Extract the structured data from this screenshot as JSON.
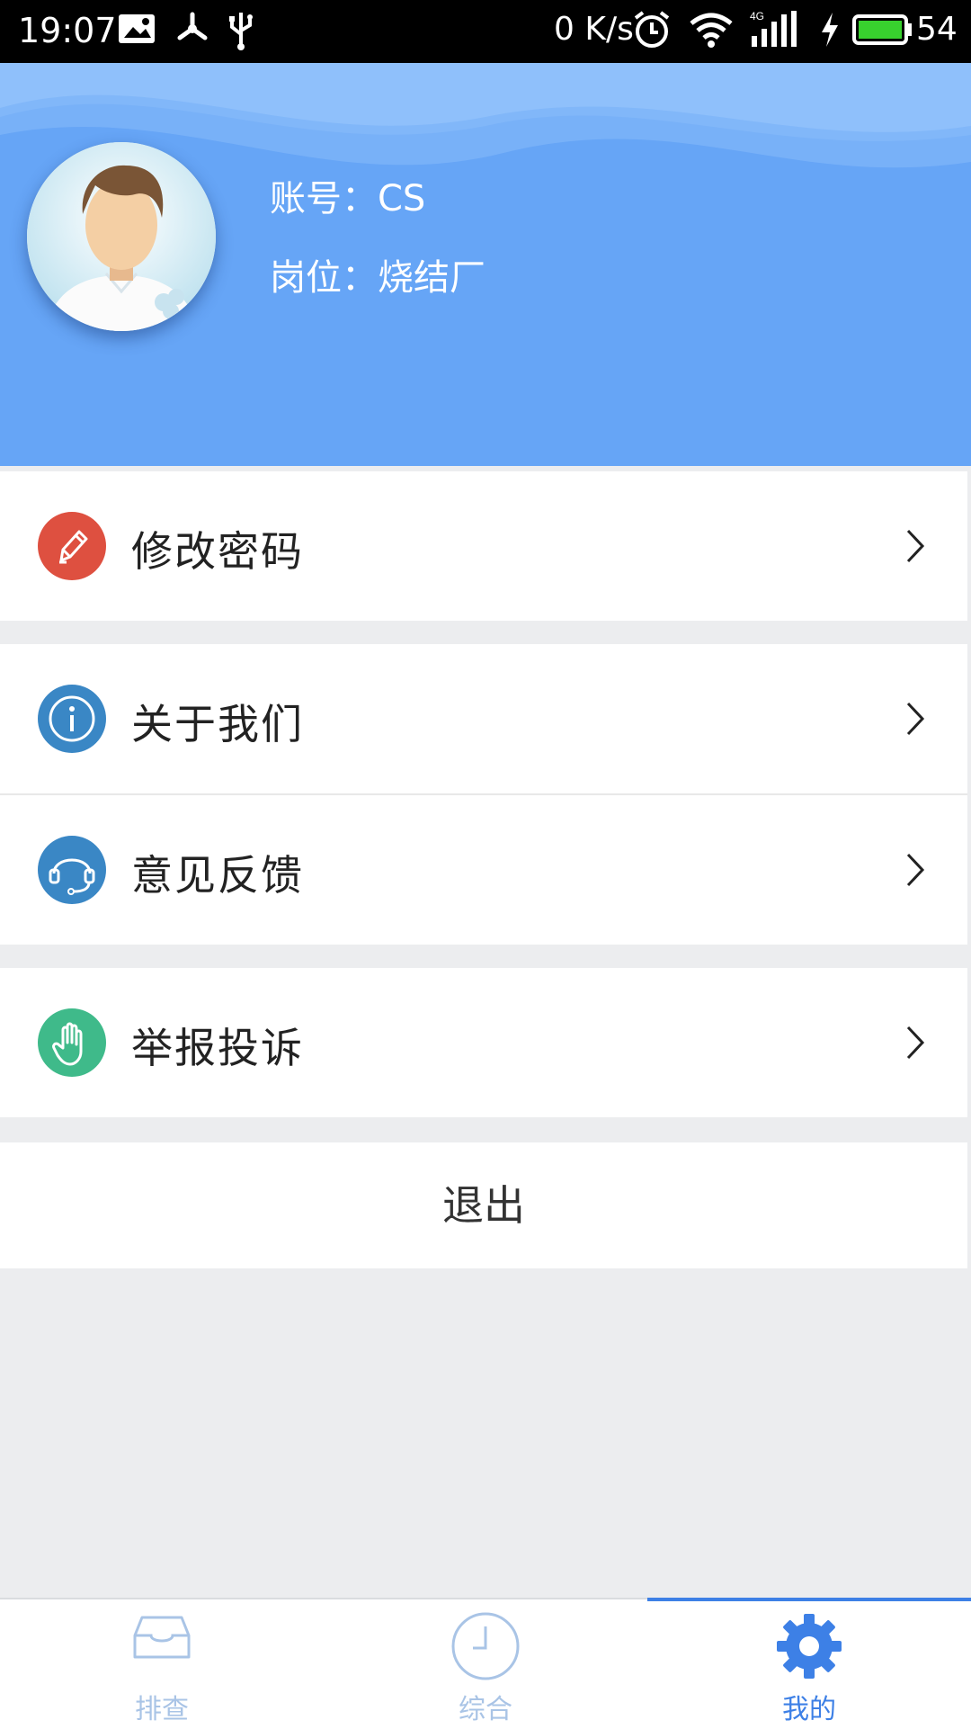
{
  "status_bar": {
    "time": "19:07",
    "speed": "0 K/s",
    "battery": "54"
  },
  "profile": {
    "account_label": "账号：",
    "account_value": "CS",
    "position_label": "岗位：",
    "position_value": "烧结厂",
    "colors": {
      "header": "#66a5f6"
    }
  },
  "menu": {
    "items": [
      {
        "label": "修改密码",
        "icon": "pencil-icon",
        "color": "#de5040"
      },
      {
        "label": "关于我们",
        "icon": "info-icon",
        "color": "#3a87c5"
      },
      {
        "label": "意见反馈",
        "icon": "headset-icon",
        "color": "#3a87c5"
      },
      {
        "label": "举报投诉",
        "icon": "hand-icon",
        "color": "#3fba8a"
      }
    ],
    "logout_label": "退出"
  },
  "tabs": [
    {
      "label": "排查",
      "icon": "inbox-icon",
      "active": false
    },
    {
      "label": "综合",
      "icon": "clock-icon",
      "active": false
    },
    {
      "label": "我的",
      "icon": "gear-icon",
      "active": true
    }
  ]
}
